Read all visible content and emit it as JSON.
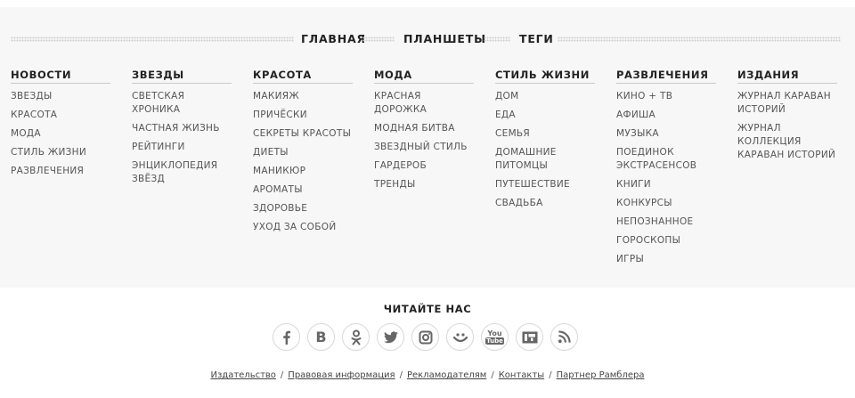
{
  "top_nav": [
    "ГЛАВНАЯ",
    "ПЛАНШЕТЫ",
    "ТЕГИ"
  ],
  "columns": [
    {
      "title": "НОВОСТИ",
      "items": [
        "ЗВЕЗДЫ",
        "КРАСОТА",
        "МОДА",
        "СТИЛЬ ЖИЗНИ",
        "РАЗВЛЕЧЕНИЯ"
      ]
    },
    {
      "title": "ЗВЕЗДЫ",
      "items": [
        "СВЕТСКАЯ ХРОНИКА",
        "ЧАСТНАЯ ЖИЗНЬ",
        "РЕЙТИНГИ",
        "ЭНЦИКЛОПЕДИЯ ЗВЁЗД"
      ]
    },
    {
      "title": "КРАСОТА",
      "items": [
        "МАКИЯЖ",
        "ПРИЧЁСКИ",
        "СЕКРЕТЫ КРАСОТЫ",
        "ДИЕТЫ",
        "МАНИКЮР",
        "АРОМАТЫ",
        "ЗДОРОВЬЕ",
        "УХОД ЗА СОБОЙ"
      ]
    },
    {
      "title": "МОДА",
      "items": [
        "КРАСНАЯ ДОРОЖКА",
        "МОДНАЯ БИТВА",
        "ЗВЕЗДНЫЙ СТИЛЬ",
        "ГАРДЕРОБ",
        "ТРЕНДЫ"
      ]
    },
    {
      "title": "СТИЛЬ ЖИЗНИ",
      "items": [
        "ДОМ",
        "ЕДА",
        "СЕМЬЯ",
        "ДОМАШНИЕ ПИТОМЦЫ",
        "ПУТЕШЕСТВИЕ",
        "СВАДЬБА"
      ]
    },
    {
      "title": "РАЗВЛЕЧЕНИЯ",
      "items": [
        "КИНО + ТВ",
        "АФИША",
        "МУЗЫКА",
        "ПОЕДИНОК ЭКСТРАСЕНСОВ",
        "КНИГИ",
        "КОНКУРСЫ",
        "НЕПОЗНАННОЕ",
        "ГОРОСКОПЫ",
        "ИГРЫ"
      ]
    },
    {
      "title": "ИЗДАНИЯ",
      "items": [
        "ЖУРНАЛ КАРАВАН ИСТОРИЙ",
        "ЖУРНАЛ КОЛЛЕКЦИЯ КАРАВАН ИСТОРИЙ"
      ]
    }
  ],
  "read_us": "ЧИТАЙТЕ НАС",
  "socials": [
    {
      "icon": "facebook-icon"
    },
    {
      "icon": "vkontakte-icon",
      "glyph": "B"
    },
    {
      "icon": "odnoklassniki-icon"
    },
    {
      "icon": "twitter-icon"
    },
    {
      "icon": "instagram-icon"
    },
    {
      "icon": "moi-mir-icon"
    },
    {
      "icon": "youtube-icon",
      "glyph_top": "You",
      "glyph_bottom": "Tube"
    },
    {
      "icon": "livejournal-icon"
    },
    {
      "icon": "rss-icon"
    }
  ],
  "bottom_links": [
    "Издательство",
    "Правовая информация",
    "Рекламодателям",
    "Контакты",
    "Партнер Рамблера"
  ],
  "colors": {
    "footer_bg": "#f7f7f7",
    "text": "#444444",
    "heading": "#222222",
    "icon": "#666666"
  }
}
